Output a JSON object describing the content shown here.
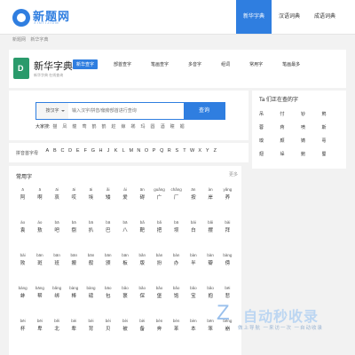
{
  "logo": {
    "text": "新题网",
    "sub": "XINTIJIDM"
  },
  "nav": [
    {
      "label": "新华字典",
      "active": true
    },
    {
      "label": "汉语词典",
      "active": false
    },
    {
      "label": "成语词典",
      "active": false
    }
  ],
  "breadcrumb": [
    "新题网",
    "新华字典"
  ],
  "header": {
    "title": "新华字典",
    "subtitle": "新华字典 在线查询",
    "tabs": [
      {
        "label": "新华查字",
        "active": true
      },
      {
        "label": "部首查字",
        "active": false
      },
      {
        "label": "笔画查字",
        "active": false
      },
      {
        "label": "多音字",
        "active": false
      },
      {
        "label": "组词",
        "active": false
      },
      {
        "label": "常用字",
        "active": false
      },
      {
        "label": "笔画最多",
        "active": false
      }
    ]
  },
  "search": {
    "select": "按汉字",
    "placeholder": "输入汉字/拼音/偏旁部首进行查询",
    "button": "查询",
    "hot_label": "大家搜:",
    "hot_words": [
      "猫",
      "凤",
      "龍",
      "莺",
      "鹤",
      "鹤",
      "趁",
      "鲸",
      "鹕",
      "玛",
      "圆",
      "酒",
      "瞳",
      "媚"
    ]
  },
  "side": {
    "title": "Ta 们正在查的字",
    "chars": [
      "吊",
      "忖",
      "钞",
      "鹪",
      "蓉",
      "蒋",
      "喷",
      "斯",
      "嗅",
      "颇",
      "铸",
      "萼",
      "翅",
      "垛",
      "鲍",
      "蜀"
    ]
  },
  "alpha": {
    "label": "拼音首字母",
    "letters": [
      "A",
      "B",
      "C",
      "D",
      "E",
      "F",
      "G",
      "H",
      "J",
      "K",
      "L",
      "M",
      "N",
      "O",
      "P",
      "Q",
      "R",
      "S",
      "T",
      "W",
      "X",
      "Y",
      "Z"
    ]
  },
  "common": {
    "title": "常用字",
    "more": "更多",
    "rows": [
      [
        [
          "ā",
          "阿"
        ],
        [
          "ā",
          "啊"
        ],
        [
          "āi",
          "哀"
        ],
        [
          "āi",
          "哎"
        ],
        [
          "āi",
          "埃"
        ],
        [
          "ǎi",
          "矮"
        ],
        [
          "ài",
          "爱"
        ],
        [
          "ān",
          "碍"
        ],
        [
          "guǎng",
          "广"
        ],
        [
          "chǎng",
          "厂"
        ],
        [
          "ān",
          "按"
        ],
        [
          "àn",
          "岸"
        ],
        [
          "yǎng",
          "养"
        ]
      ],
      [
        [
          "ào",
          "袁"
        ],
        [
          "áo",
          "敖"
        ],
        [
          "bā",
          "吧"
        ],
        [
          "bā",
          "捌"
        ],
        [
          "bā",
          "扒"
        ],
        [
          "bā",
          "巴"
        ],
        [
          "bā",
          "八"
        ],
        [
          "bǎ",
          "靶"
        ],
        [
          "bǎ",
          "把"
        ],
        [
          "bā",
          "坝"
        ],
        [
          "bái",
          "白"
        ],
        [
          "bǎi",
          "摆"
        ],
        [
          "bài",
          "拜"
        ]
      ],
      [
        [
          "bài",
          "败"
        ],
        [
          "bān",
          "斑"
        ],
        [
          "bān",
          "班"
        ],
        [
          "bān",
          "搬"
        ],
        [
          "bān",
          "般"
        ],
        [
          "bān",
          "颁"
        ],
        [
          "bān",
          "板"
        ],
        [
          "bǎn",
          "版"
        ],
        [
          "bàn",
          "扮"
        ],
        [
          "bàn",
          "办"
        ],
        [
          "bàn",
          "半"
        ],
        [
          "bàn",
          "瓣"
        ],
        [
          "bàng",
          "傍"
        ]
      ],
      [
        [
          "bàng",
          "蚌"
        ],
        [
          "bāng",
          "帮"
        ],
        [
          "bǎng",
          "绑"
        ],
        [
          "bàng",
          "棒"
        ],
        [
          "bàng",
          "磅"
        ],
        [
          "bāo",
          "包"
        ],
        [
          "bǎo",
          "褒"
        ],
        [
          "bǎo",
          "保"
        ],
        [
          "bǎo",
          "堡"
        ],
        [
          "bǎo",
          "饱"
        ],
        [
          "bǎo",
          "宝"
        ],
        [
          "bǎo",
          "抱"
        ],
        [
          "bēi",
          "悲"
        ]
      ],
      [
        [
          "bēi",
          "杯"
        ],
        [
          "bēi",
          "卑"
        ],
        [
          "běi",
          "北"
        ],
        [
          "bèi",
          "辈"
        ],
        [
          "bèi",
          "背"
        ],
        [
          "bèi",
          "贝"
        ],
        [
          "bèi",
          "被"
        ],
        [
          "bèi",
          "备"
        ],
        [
          "bèn",
          "奔"
        ],
        [
          "bèn",
          "苯"
        ],
        [
          "bèn",
          "本"
        ],
        [
          "bēn",
          "笨"
        ],
        [
          "bēng",
          "崩"
        ]
      ]
    ]
  },
  "watermark": {
    "mark": "Z",
    "text": "自动秒收录",
    "sub": "做上导航 一来访一次 一自动收录"
  }
}
